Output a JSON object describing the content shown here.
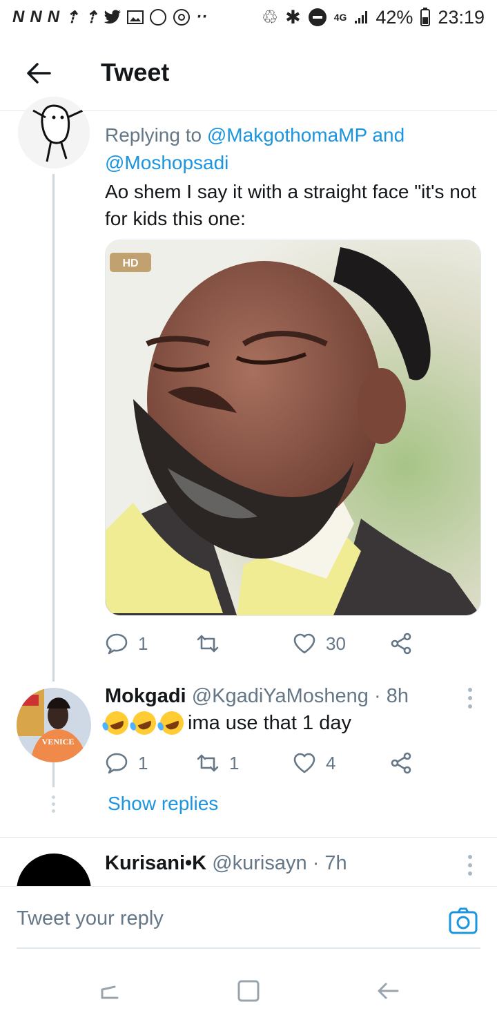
{
  "status_bar": {
    "icons_left": [
      "N",
      "N",
      "N",
      "upload-icon",
      "upload-icon",
      "twitter-icon",
      "gallery-icon",
      "whatsapp-icon",
      "sync-icon",
      "more-dots"
    ],
    "network": "4G",
    "battery": "42%",
    "time": "23:19"
  },
  "header": {
    "title": "Tweet"
  },
  "tweet1": {
    "reply_prefix": "Replying to ",
    "reply_user1": "@MakgothomaMP",
    "reply_and": " and",
    "reply_user2": "@Moshopsadi",
    "text": "Ao shem I say it with a straight face \"it's not for kids this one:",
    "media_badge": "HD",
    "replies": "1",
    "retweets": "",
    "likes": "30"
  },
  "tweet2": {
    "name": "Mokgadi",
    "handle": "@KgadiYaMosheng",
    "time": "· 8h",
    "text": "ima use that 1 day",
    "replies": "1",
    "retweets": "1",
    "likes": "4",
    "avatar_text": "VENICE"
  },
  "show_replies": "Show replies",
  "tweet3": {
    "name": "Kurisani•K",
    "handle": "@kurisayn",
    "time": "· 7h"
  },
  "reply_bar": {
    "placeholder": "Tweet your reply"
  }
}
